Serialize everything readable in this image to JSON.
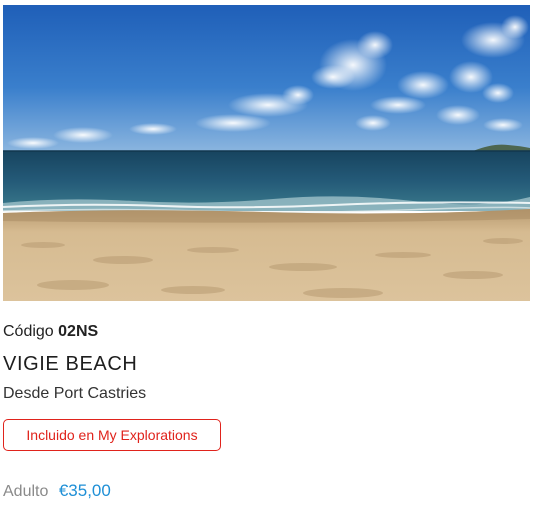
{
  "excursion": {
    "code_label": "Código",
    "code_value": "02NS",
    "title": "VIGIE BEACH",
    "origin": "Desde Port Castries",
    "badge": "Incluido en My Explorations",
    "price_label": "Adulto",
    "price_value": "€35,00",
    "colors": {
      "badge": "#e0231c",
      "price": "#1e8fd6",
      "sky": "#2a6fc2",
      "sea": "#1d4e6f",
      "sand": "#d2b48a"
    }
  }
}
